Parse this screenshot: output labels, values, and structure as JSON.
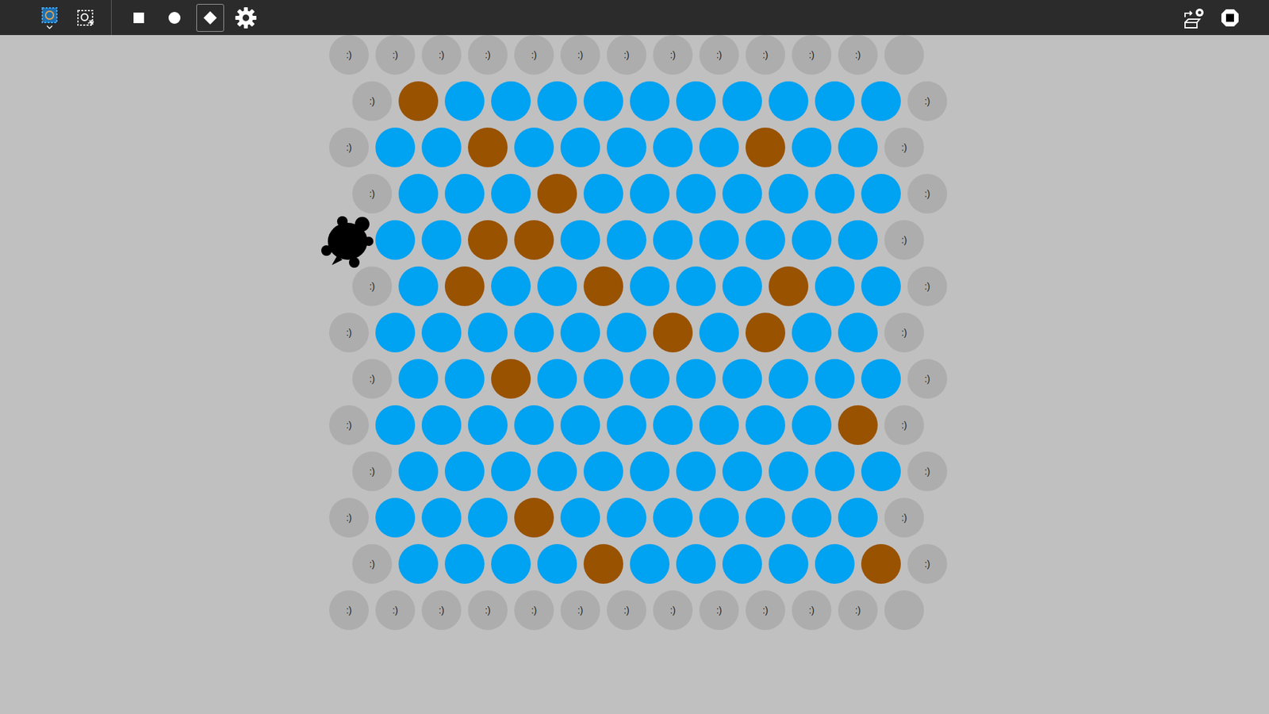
{
  "toolbar": {
    "left": [
      {
        "kind": "world",
        "dropdown": true
      },
      {
        "kind": "snapshot",
        "dropdown": false
      }
    ],
    "tools": [
      {
        "kind": "square",
        "selected": false
      },
      {
        "kind": "circle",
        "selected": false
      },
      {
        "kind": "diamond",
        "selected": true
      },
      {
        "kind": "gear",
        "selected": false
      }
    ],
    "right": [
      {
        "kind": "export"
      },
      {
        "kind": "stop"
      }
    ]
  },
  "grid": {
    "rows": [
      {
        "cells": [
          {
            "kind": "label",
            "text": ":)"
          },
          {
            "kind": "label",
            "text": ":)"
          },
          {
            "kind": "label",
            "text": ":)"
          },
          {
            "kind": "label",
            "text": ":)"
          },
          {
            "kind": "label",
            "text": ":)"
          },
          {
            "kind": "label",
            "text": ":)"
          },
          {
            "kind": "label",
            "text": ":)"
          },
          {
            "kind": "label",
            "text": ":)"
          },
          {
            "kind": "label",
            "text": ":)"
          },
          {
            "kind": "label",
            "text": ":)"
          },
          {
            "kind": "label",
            "text": ":)"
          },
          {
            "kind": "label",
            "text": ":)"
          },
          {
            "kind": "empty"
          }
        ]
      },
      {
        "cells": [
          {
            "kind": "label",
            "text": ":)"
          },
          {
            "kind": "patch",
            "color": "#995200"
          },
          {
            "kind": "patch",
            "color": "#00a2f2"
          },
          {
            "kind": "patch",
            "color": "#00a2f2"
          },
          {
            "kind": "patch",
            "color": "#00a2f2"
          },
          {
            "kind": "patch",
            "color": "#00a2f2"
          },
          {
            "kind": "patch",
            "color": "#00a2f2"
          },
          {
            "kind": "patch",
            "color": "#00a2f2"
          },
          {
            "kind": "patch",
            "color": "#00a2f2"
          },
          {
            "kind": "patch",
            "color": "#00a2f2"
          },
          {
            "kind": "patch",
            "color": "#00a2f2"
          },
          {
            "kind": "patch",
            "color": "#00a2f2"
          },
          {
            "kind": "label",
            "text": ":)"
          }
        ]
      },
      {
        "cells": [
          {
            "kind": "label",
            "text": ":)"
          },
          {
            "kind": "patch",
            "color": "#00a2f2"
          },
          {
            "kind": "patch",
            "color": "#00a2f2"
          },
          {
            "kind": "patch",
            "color": "#995200"
          },
          {
            "kind": "patch",
            "color": "#00a2f2"
          },
          {
            "kind": "patch",
            "color": "#00a2f2"
          },
          {
            "kind": "patch",
            "color": "#00a2f2"
          },
          {
            "kind": "patch",
            "color": "#00a2f2"
          },
          {
            "kind": "patch",
            "color": "#00a2f2"
          },
          {
            "kind": "patch",
            "color": "#995200"
          },
          {
            "kind": "patch",
            "color": "#00a2f2"
          },
          {
            "kind": "patch",
            "color": "#00a2f2"
          },
          {
            "kind": "label",
            "text": ":)"
          }
        ]
      },
      {
        "cells": [
          {
            "kind": "label",
            "text": ":)"
          },
          {
            "kind": "patch",
            "color": "#00a2f2"
          },
          {
            "kind": "patch",
            "color": "#00a2f2"
          },
          {
            "kind": "patch",
            "color": "#00a2f2"
          },
          {
            "kind": "patch",
            "color": "#995200"
          },
          {
            "kind": "patch",
            "color": "#00a2f2"
          },
          {
            "kind": "patch",
            "color": "#00a2f2"
          },
          {
            "kind": "patch",
            "color": "#00a2f2"
          },
          {
            "kind": "patch",
            "color": "#00a2f2"
          },
          {
            "kind": "patch",
            "color": "#00a2f2"
          },
          {
            "kind": "patch",
            "color": "#00a2f2"
          },
          {
            "kind": "patch",
            "color": "#00a2f2"
          },
          {
            "kind": "label",
            "text": ":)"
          }
        ]
      },
      {
        "cells": [
          {
            "kind": "turtle"
          },
          {
            "kind": "patch",
            "color": "#00a2f2"
          },
          {
            "kind": "patch",
            "color": "#00a2f2"
          },
          {
            "kind": "patch",
            "color": "#995200"
          },
          {
            "kind": "patch",
            "color": "#995200"
          },
          {
            "kind": "patch",
            "color": "#00a2f2"
          },
          {
            "kind": "patch",
            "color": "#00a2f2"
          },
          {
            "kind": "patch",
            "color": "#00a2f2"
          },
          {
            "kind": "patch",
            "color": "#00a2f2"
          },
          {
            "kind": "patch",
            "color": "#00a2f2"
          },
          {
            "kind": "patch",
            "color": "#00a2f2"
          },
          {
            "kind": "patch",
            "color": "#00a2f2"
          },
          {
            "kind": "label",
            "text": ":)"
          }
        ]
      },
      {
        "cells": [
          {
            "kind": "label",
            "text": ":)"
          },
          {
            "kind": "patch",
            "color": "#00a2f2"
          },
          {
            "kind": "patch",
            "color": "#995200"
          },
          {
            "kind": "patch",
            "color": "#00a2f2"
          },
          {
            "kind": "patch",
            "color": "#00a2f2"
          },
          {
            "kind": "patch",
            "color": "#995200"
          },
          {
            "kind": "patch",
            "color": "#00a2f2"
          },
          {
            "kind": "patch",
            "color": "#00a2f2"
          },
          {
            "kind": "patch",
            "color": "#00a2f2"
          },
          {
            "kind": "patch",
            "color": "#995200"
          },
          {
            "kind": "patch",
            "color": "#00a2f2"
          },
          {
            "kind": "patch",
            "color": "#00a2f2"
          },
          {
            "kind": "label",
            "text": ":)"
          }
        ]
      },
      {
        "cells": [
          {
            "kind": "label",
            "text": ":)"
          },
          {
            "kind": "patch",
            "color": "#00a2f2"
          },
          {
            "kind": "patch",
            "color": "#00a2f2"
          },
          {
            "kind": "patch",
            "color": "#00a2f2"
          },
          {
            "kind": "patch",
            "color": "#00a2f2"
          },
          {
            "kind": "patch",
            "color": "#00a2f2"
          },
          {
            "kind": "patch",
            "color": "#00a2f2"
          },
          {
            "kind": "patch",
            "color": "#995200"
          },
          {
            "kind": "patch",
            "color": "#00a2f2"
          },
          {
            "kind": "patch",
            "color": "#995200"
          },
          {
            "kind": "patch",
            "color": "#00a2f2"
          },
          {
            "kind": "patch",
            "color": "#00a2f2"
          },
          {
            "kind": "label",
            "text": ":)"
          }
        ]
      },
      {
        "cells": [
          {
            "kind": "label",
            "text": ":)"
          },
          {
            "kind": "patch",
            "color": "#00a2f2"
          },
          {
            "kind": "patch",
            "color": "#00a2f2"
          },
          {
            "kind": "patch",
            "color": "#995200"
          },
          {
            "kind": "patch",
            "color": "#00a2f2"
          },
          {
            "kind": "patch",
            "color": "#00a2f2"
          },
          {
            "kind": "patch",
            "color": "#00a2f2"
          },
          {
            "kind": "patch",
            "color": "#00a2f2"
          },
          {
            "kind": "patch",
            "color": "#00a2f2"
          },
          {
            "kind": "patch",
            "color": "#00a2f2"
          },
          {
            "kind": "patch",
            "color": "#00a2f2"
          },
          {
            "kind": "patch",
            "color": "#00a2f2"
          },
          {
            "kind": "label",
            "text": ":)"
          }
        ]
      },
      {
        "cells": [
          {
            "kind": "label",
            "text": ":)"
          },
          {
            "kind": "patch",
            "color": "#00a2f2"
          },
          {
            "kind": "patch",
            "color": "#00a2f2"
          },
          {
            "kind": "patch",
            "color": "#00a2f2"
          },
          {
            "kind": "patch",
            "color": "#00a2f2"
          },
          {
            "kind": "patch",
            "color": "#00a2f2"
          },
          {
            "kind": "patch",
            "color": "#00a2f2"
          },
          {
            "kind": "patch",
            "color": "#00a2f2"
          },
          {
            "kind": "patch",
            "color": "#00a2f2"
          },
          {
            "kind": "patch",
            "color": "#00a2f2"
          },
          {
            "kind": "patch",
            "color": "#00a2f2"
          },
          {
            "kind": "patch",
            "color": "#995200"
          },
          {
            "kind": "label",
            "text": ":)"
          }
        ]
      },
      {
        "cells": [
          {
            "kind": "label",
            "text": ":)"
          },
          {
            "kind": "patch",
            "color": "#00a2f2"
          },
          {
            "kind": "patch",
            "color": "#00a2f2"
          },
          {
            "kind": "patch",
            "color": "#00a2f2"
          },
          {
            "kind": "patch",
            "color": "#00a2f2"
          },
          {
            "kind": "patch",
            "color": "#00a2f2"
          },
          {
            "kind": "patch",
            "color": "#00a2f2"
          },
          {
            "kind": "patch",
            "color": "#00a2f2"
          },
          {
            "kind": "patch",
            "color": "#00a2f2"
          },
          {
            "kind": "patch",
            "color": "#00a2f2"
          },
          {
            "kind": "patch",
            "color": "#00a2f2"
          },
          {
            "kind": "patch",
            "color": "#00a2f2"
          },
          {
            "kind": "label",
            "text": ":)"
          }
        ]
      },
      {
        "cells": [
          {
            "kind": "label",
            "text": ":)"
          },
          {
            "kind": "patch",
            "color": "#00a2f2"
          },
          {
            "kind": "patch",
            "color": "#00a2f2"
          },
          {
            "kind": "patch",
            "color": "#00a2f2"
          },
          {
            "kind": "patch",
            "color": "#995200"
          },
          {
            "kind": "patch",
            "color": "#00a2f2"
          },
          {
            "kind": "patch",
            "color": "#00a2f2"
          },
          {
            "kind": "patch",
            "color": "#00a2f2"
          },
          {
            "kind": "patch",
            "color": "#00a2f2"
          },
          {
            "kind": "patch",
            "color": "#00a2f2"
          },
          {
            "kind": "patch",
            "color": "#00a2f2"
          },
          {
            "kind": "patch",
            "color": "#00a2f2"
          },
          {
            "kind": "label",
            "text": ":)"
          }
        ]
      },
      {
        "cells": [
          {
            "kind": "label",
            "text": ":)"
          },
          {
            "kind": "patch",
            "color": "#00a2f2"
          },
          {
            "kind": "patch",
            "color": "#00a2f2"
          },
          {
            "kind": "patch",
            "color": "#00a2f2"
          },
          {
            "kind": "patch",
            "color": "#00a2f2"
          },
          {
            "kind": "patch",
            "color": "#995200"
          },
          {
            "kind": "patch",
            "color": "#00a2f2"
          },
          {
            "kind": "patch",
            "color": "#00a2f2"
          },
          {
            "kind": "patch",
            "color": "#00a2f2"
          },
          {
            "kind": "patch",
            "color": "#00a2f2"
          },
          {
            "kind": "patch",
            "color": "#00a2f2"
          },
          {
            "kind": "patch",
            "color": "#995200"
          },
          {
            "kind": "label",
            "text": ":)"
          }
        ]
      },
      {
        "cells": [
          {
            "kind": "label",
            "text": ":)"
          },
          {
            "kind": "label",
            "text": ":)"
          },
          {
            "kind": "label",
            "text": ":)"
          },
          {
            "kind": "label",
            "text": ":)"
          },
          {
            "kind": "label",
            "text": ":)"
          },
          {
            "kind": "label",
            "text": ":)"
          },
          {
            "kind": "label",
            "text": ":)"
          },
          {
            "kind": "label",
            "text": ":)"
          },
          {
            "kind": "label",
            "text": ":)"
          },
          {
            "kind": "label",
            "text": ":)"
          },
          {
            "kind": "label",
            "text": ":)"
          },
          {
            "kind": "label",
            "text": ":)"
          },
          {
            "kind": "empty"
          }
        ]
      }
    ]
  }
}
